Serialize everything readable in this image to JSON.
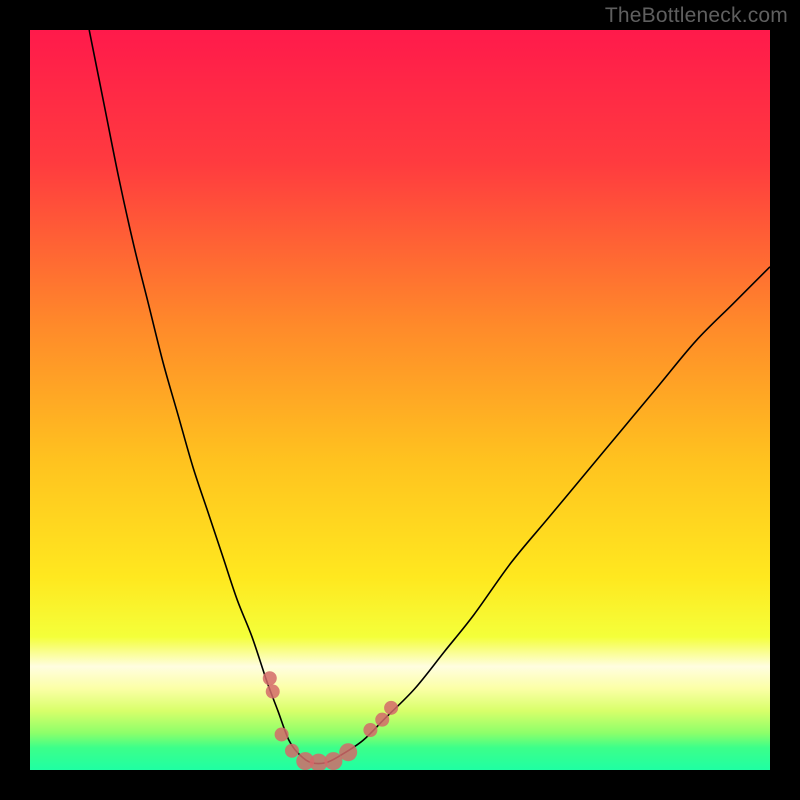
{
  "watermark": "TheBottleneck.com",
  "chart_data": {
    "type": "line",
    "title": "",
    "xlabel": "",
    "ylabel": "",
    "xlim": [
      0,
      100
    ],
    "ylim": [
      0,
      100
    ],
    "grid": false,
    "legend": false,
    "gradient_stops": [
      {
        "offset": 0,
        "color": "#ff1a4b"
      },
      {
        "offset": 18,
        "color": "#ff3b3f"
      },
      {
        "offset": 40,
        "color": "#ff8a2a"
      },
      {
        "offset": 58,
        "color": "#ffc21f"
      },
      {
        "offset": 74,
        "color": "#ffe81f"
      },
      {
        "offset": 82,
        "color": "#f4ff3a"
      },
      {
        "offset": 86,
        "color": "#fffde0"
      },
      {
        "offset": 89,
        "color": "#fbffa6"
      },
      {
        "offset": 92,
        "color": "#d8ff6a"
      },
      {
        "offset": 95,
        "color": "#8dff6a"
      },
      {
        "offset": 97,
        "color": "#3cff8a"
      },
      {
        "offset": 100,
        "color": "#1fffa3"
      }
    ],
    "series": [
      {
        "name": "bottleneck-curve",
        "color": "#000000",
        "stroke_width": 1.6,
        "x": [
          8,
          10,
          12,
          14,
          16,
          18,
          20,
          22,
          24,
          26,
          28,
          30,
          32,
          33.5,
          35,
          36.5,
          38,
          40,
          42,
          45,
          48,
          52,
          56,
          60,
          65,
          70,
          75,
          80,
          85,
          90,
          95,
          100
        ],
        "y": [
          100,
          90,
          80,
          71,
          63,
          55,
          48,
          41,
          35,
          29,
          23,
          18,
          12,
          8,
          4,
          2,
          1,
          1,
          2,
          4,
          7,
          11,
          16,
          21,
          28,
          34,
          40,
          46,
          52,
          58,
          63,
          68
        ]
      }
    ],
    "marker_series": {
      "name": "critical-points",
      "color": "#d46a6a",
      "opacity": 0.85,
      "points": [
        {
          "x": 32.4,
          "y": 12.4,
          "r": 7
        },
        {
          "x": 32.8,
          "y": 10.6,
          "r": 7
        },
        {
          "x": 34.0,
          "y": 4.8,
          "r": 7
        },
        {
          "x": 35.4,
          "y": 2.6,
          "r": 7
        },
        {
          "x": 37.2,
          "y": 1.2,
          "r": 9
        },
        {
          "x": 39.0,
          "y": 1.0,
          "r": 9
        },
        {
          "x": 41.0,
          "y": 1.2,
          "r": 9
        },
        {
          "x": 43.0,
          "y": 2.4,
          "r": 9
        },
        {
          "x": 46.0,
          "y": 5.4,
          "r": 7
        },
        {
          "x": 47.6,
          "y": 6.8,
          "r": 7
        },
        {
          "x": 48.8,
          "y": 8.4,
          "r": 7
        }
      ]
    }
  }
}
